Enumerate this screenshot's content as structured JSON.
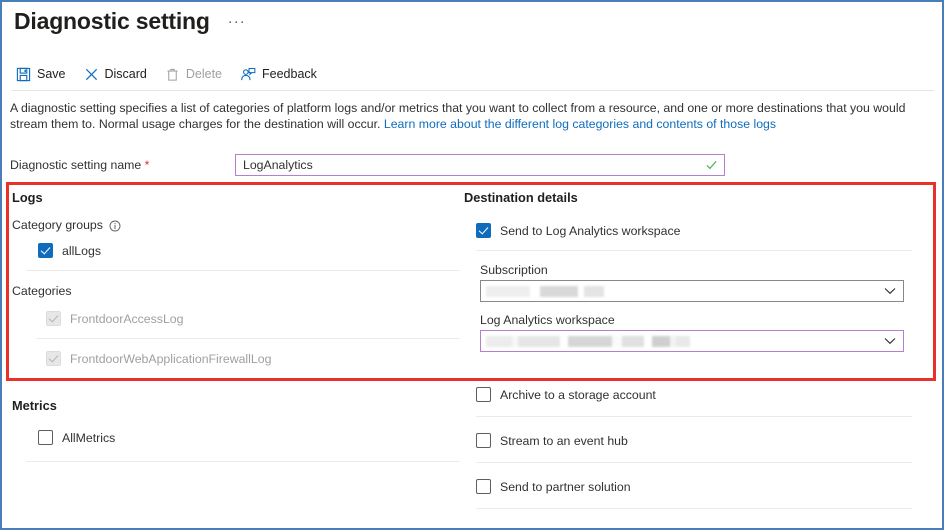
{
  "header": {
    "title": "Diagnostic setting",
    "more_label": "···"
  },
  "toolbar": {
    "save_label": "Save",
    "discard_label": "Discard",
    "delete_label": "Delete",
    "feedback_label": "Feedback"
  },
  "description": {
    "text_before_link": "A diagnostic setting specifies a list of categories of platform logs and/or metrics that you want to collect from a resource, and one or more destinations that you would stream them to. Normal usage charges for the destination will occur. ",
    "link_text": "Learn more about the different log categories and contents of those logs"
  },
  "setting_name": {
    "label": "Diagnostic setting name",
    "required_marker": "*",
    "value": "LogAnalytics",
    "placeholder": "",
    "valid": true
  },
  "logs": {
    "heading": "Logs",
    "category_groups_label": "Category groups",
    "category_groups_info_icon": "info-icon",
    "group_items": [
      {
        "label": "allLogs",
        "checked": true,
        "disabled": false
      }
    ],
    "categories_label": "Categories",
    "category_items": [
      {
        "label": "FrontdoorAccessLog",
        "checked": true,
        "disabled": true
      },
      {
        "label": "FrontdoorWebApplicationFirewallLog",
        "checked": true,
        "disabled": true
      }
    ]
  },
  "metrics": {
    "heading": "Metrics",
    "items": [
      {
        "label": "AllMetrics",
        "checked": false,
        "disabled": false
      }
    ]
  },
  "destination": {
    "heading": "Destination details",
    "log_analytics": {
      "label": "Send to Log Analytics workspace",
      "checked": true,
      "subscription_label": "Subscription",
      "subscription_value": "",
      "workspace_label": "Log Analytics workspace",
      "workspace_value": ""
    },
    "options": [
      {
        "label": "Archive to a storage account",
        "checked": false
      },
      {
        "label": "Stream to an event hub",
        "checked": false
      },
      {
        "label": "Send to partner solution",
        "checked": false
      }
    ]
  },
  "colors": {
    "accent_blue": "#0f6cbd",
    "link_blue": "#0f6cbd",
    "highlight_red": "#e8312a",
    "field_purple": "#b37fce",
    "valid_green": "#4caf50",
    "outer_border_blue": "#4a7ebb",
    "disabled_gray": "#a19f9d"
  }
}
